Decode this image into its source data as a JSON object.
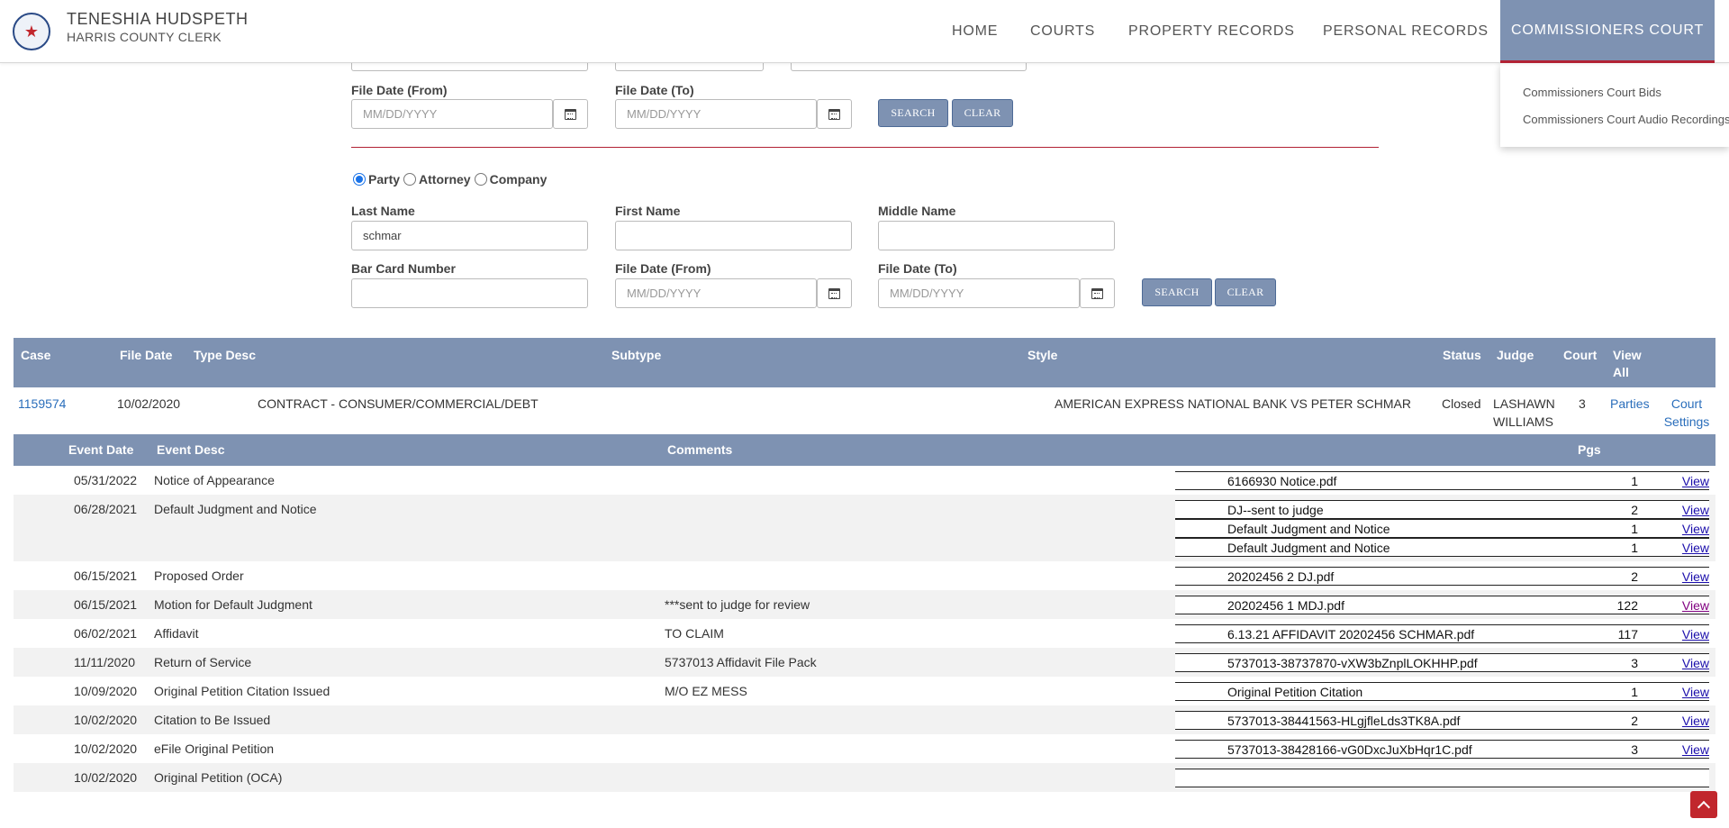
{
  "brand": {
    "name": "TENESHIA HUDSPETH",
    "subtitle": "HARRIS COUNTY CLERK"
  },
  "nav": {
    "home": "HOME",
    "courts": "COURTS",
    "property": "PROPERTY RECORDS",
    "personal": "PERSONAL RECORDS",
    "commissioners": "COMMISSIONERS COURT"
  },
  "dropdown": {
    "item1": "Commissioners Court Bids",
    "item2": "Commissioners Court Audio Recordings"
  },
  "form1": {
    "file_from_label": "File Date (From)",
    "file_to_label": "File Date (To)",
    "date_placeholder": "MM/DD/YYYY",
    "search": "SEARCH",
    "clear": "CLEAR"
  },
  "form2": {
    "radio_party": "Party",
    "radio_attorney": "Attorney",
    "radio_company": "Company",
    "selected": "Party",
    "last_name_label": "Last Name",
    "last_name_value": "schmar",
    "first_name_label": "First Name",
    "middle_name_label": "Middle Name",
    "bar_card_label": "Bar Card Number",
    "file_from_label": "File Date (From)",
    "file_to_label": "File Date (To)",
    "date_placeholder": "MM/DD/YYYY",
    "search": "SEARCH",
    "clear": "CLEAR"
  },
  "results": {
    "headers": {
      "case": "Case",
      "file_date": "File Date",
      "type_desc": "Type Desc",
      "subtype": "Subtype",
      "style": "Style",
      "status": "Status",
      "judge": "Judge",
      "court": "Court",
      "view_all": "View All"
    },
    "row": {
      "case": "1159574",
      "file_date": "10/02/2020",
      "type_desc": "CONTRACT - CONSUMER/COMMERCIAL/DEBT",
      "style": "AMERICAN EXPRESS NATIONAL BANK VS PETER SCHMAR",
      "status": "Closed",
      "judge": "LASHAWN WILLIAMS",
      "court": "3",
      "parties": "Parties",
      "court_settings": "Court Settings"
    }
  },
  "events": {
    "headers": {
      "date": "Event Date",
      "desc": "Event Desc",
      "comments": "Comments",
      "pgs": "Pgs"
    },
    "view_label": "View",
    "rows": [
      {
        "date": "05/31/2022",
        "desc": "Notice of Appearance",
        "comment": "",
        "docs": [
          {
            "name": "6166930 Notice.pdf",
            "pgs": "1"
          }
        ]
      },
      {
        "date": "06/28/2021",
        "desc": "Default Judgment and Notice",
        "comment": "",
        "docs": [
          {
            "name": "DJ--sent to judge",
            "pgs": "2"
          },
          {
            "name": "Default Judgment and Notice",
            "pgs": "1"
          },
          {
            "name": "Default Judgment and Notice",
            "pgs": "1"
          }
        ]
      },
      {
        "date": "06/15/2021",
        "desc": "Proposed Order",
        "comment": "",
        "docs": [
          {
            "name": "20202456 2 DJ.pdf",
            "pgs": "2"
          }
        ]
      },
      {
        "date": "06/15/2021",
        "desc": "Motion for Default Judgment",
        "comment": "***sent to judge for review",
        "docs": [
          {
            "name": "20202456 1 MDJ.pdf",
            "pgs": "122"
          }
        ]
      },
      {
        "date": "06/02/2021",
        "desc": "Affidavit",
        "comment": "TO CLAIM",
        "docs": [
          {
            "name": "6.13.21 AFFIDAVIT 20202456 SCHMAR.pdf",
            "pgs": "117"
          }
        ]
      },
      {
        "date": "11/11/2020",
        "desc": "Return of Service",
        "comment": "5737013 Affidavit File Pack",
        "docs": [
          {
            "name": "5737013-38737870-vXW3bZnplLOKHHP.pdf",
            "pgs": "3"
          }
        ]
      },
      {
        "date": "10/09/2020",
        "desc": "Original Petition Citation Issued",
        "comment": "M/O EZ MESS",
        "docs": [
          {
            "name": "Original Petition Citation",
            "pgs": "1"
          }
        ]
      },
      {
        "date": "10/02/2020",
        "desc": "Citation to Be Issued",
        "comment": "",
        "docs": [
          {
            "name": "5737013-38441563-HLgjfleLds3TK8A.pdf",
            "pgs": "2"
          }
        ]
      },
      {
        "date": "10/02/2020",
        "desc": "eFile Original Petition",
        "comment": "",
        "docs": [
          {
            "name": "5737013-38428166-vG0DxcJuXbHqr1C.pdf",
            "pgs": "3"
          }
        ]
      },
      {
        "date": "10/02/2020",
        "desc": "Original Petition (OCA)",
        "comment": "",
        "docs": []
      }
    ]
  },
  "icons": {
    "calendar": "calendar-icon",
    "back_to_top": "chevron-up-icon",
    "logo": "county-seal-icon"
  },
  "colors": {
    "header_blue": "#7e92b2",
    "accent_red": "#b22234",
    "link_blue": "#2a6ebb"
  }
}
